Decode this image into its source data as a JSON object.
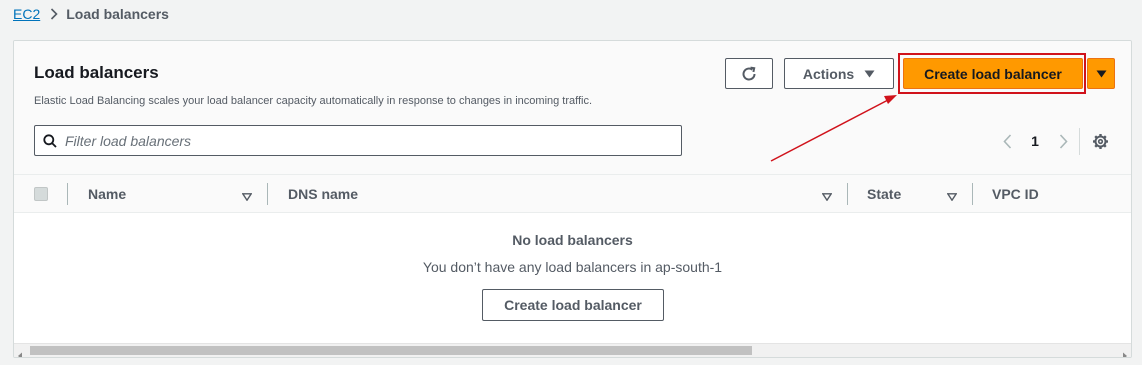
{
  "breadcrumb": {
    "root": "EC2",
    "current": "Load balancers"
  },
  "panel": {
    "title": "Load balancers",
    "description": "Elastic Load Balancing scales your load balancer capacity automatically in response to changes in incoming traffic.",
    "actions_label": "Actions",
    "create_label": "Create load balancer",
    "filter_placeholder": "Filter load balancers",
    "page_number": "1"
  },
  "table": {
    "columns": [
      "Name",
      "DNS name",
      "State",
      "VPC ID"
    ],
    "empty_title": "No load balancers",
    "empty_message": "You don’t have any load balancers in ap-south-1",
    "empty_button": "Create load balancer"
  },
  "icons": {
    "refresh": "refresh-icon",
    "caret": "caret-down-icon",
    "search": "search-icon",
    "settings": "gear-icon"
  },
  "colors": {
    "primary": "#ff9900",
    "link": "#0073bb",
    "annotation": "#d0121b"
  }
}
